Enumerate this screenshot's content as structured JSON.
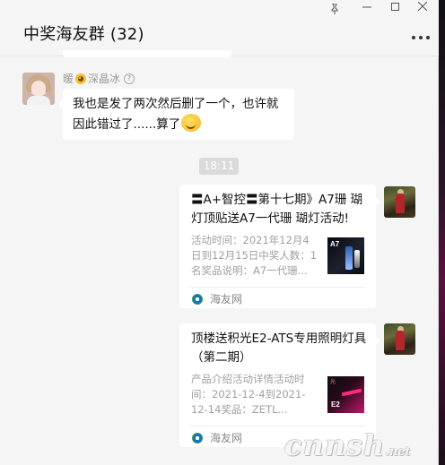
{
  "window": {
    "pin_icon": "pin-icon",
    "minimize_icon": "minimize-icon",
    "maximize_icon": "maximize-icon",
    "close_icon": "close-icon"
  },
  "header": {
    "title": "中奖海友群 (32)",
    "more_icon": "more-horizontal-icon"
  },
  "messages": [
    {
      "sender_name": "暖",
      "sender_suffix": "深晶冰",
      "text": "我也是发了两次然后删了一个，也许就因此错过了......算了"
    }
  ],
  "time_divider": "18:11",
  "cards": [
    {
      "title": "〓A+智控〓第十七期》A7珊 瑚灯顶贴送A7一代珊 瑚灯活动!",
      "desc": "活动时间：2021年12月4日到12月15日中奖人数：1名奖品说明：A7一代珊...",
      "thumb_label": "A7",
      "source": "海友网"
    },
    {
      "title": "顶楼送积光E2-ATS专用照明灯具（第二期）",
      "desc": "产品介绍活动详情活动时间：2021-12-4到2021-12-14奖品：ZETL...",
      "thumb_label_top": "光",
      "thumb_label_bottom": "E2",
      "source": "海友网"
    }
  ],
  "watermark": {
    "main": "cnnsh",
    "small": ".net"
  }
}
